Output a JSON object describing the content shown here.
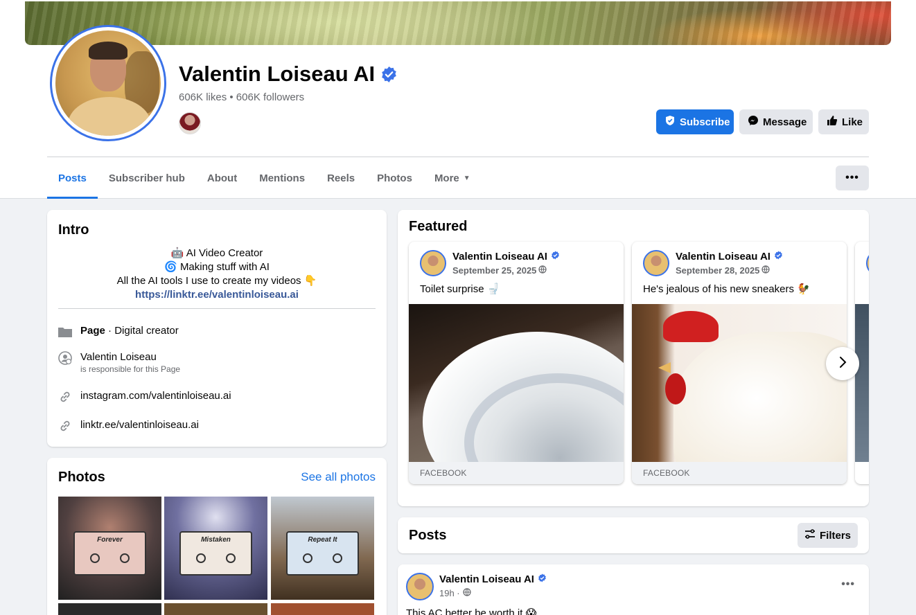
{
  "page": {
    "name": "Valentin Loiseau AI",
    "stats": "606K likes • 606K followers"
  },
  "actions": {
    "subscribe": "Subscribe",
    "message": "Message",
    "like": "Like"
  },
  "tabs": [
    {
      "label": "Posts",
      "active": true
    },
    {
      "label": "Subscriber hub"
    },
    {
      "label": "About"
    },
    {
      "label": "Mentions"
    },
    {
      "label": "Reels"
    },
    {
      "label": "Photos"
    },
    {
      "label": "More"
    }
  ],
  "more_dots": "•••",
  "intro": {
    "title": "Intro",
    "bio": [
      "🤖 AI Video Creator",
      "🌀 Making stuff with AI",
      "All the AI tools I use to create my videos 👇"
    ],
    "link": "https://linktr.ee/valentinloiseau.ai",
    "page_type_label": "Page",
    "page_type_value": " · Digital creator",
    "responsible_name": "Valentin Loiseau",
    "responsible_sub": "is responsible for this Page",
    "instagram": "instagram.com/valentinloiseau.ai",
    "linktree": "linktr.ee/valentinloiseau.ai"
  },
  "photos": {
    "title": "Photos",
    "see_all": "See all photos",
    "cassette_labels": [
      "Forever",
      "Mistaken",
      "Repeat It"
    ]
  },
  "featured": {
    "title": "Featured",
    "items": [
      {
        "author": "Valentin Loiseau AI",
        "date": "September 25, 2025",
        "text": "Toilet surprise 🚽",
        "source": "FACEBOOK"
      },
      {
        "author": "Valentin Loiseau AI",
        "date": "September 28, 2025",
        "text": "He's jealous of his new sneakers 🐓",
        "source": "FACEBOOK"
      }
    ]
  },
  "posts": {
    "title": "Posts",
    "filters": "Filters",
    "first": {
      "author": "Valentin Loiseau AI",
      "time": "19h ·",
      "text": "This AC better be worth it 😱"
    }
  },
  "colors": {
    "accent": "#1b74e4",
    "verified": "#3b72e8",
    "background": "#f0f2f5"
  }
}
